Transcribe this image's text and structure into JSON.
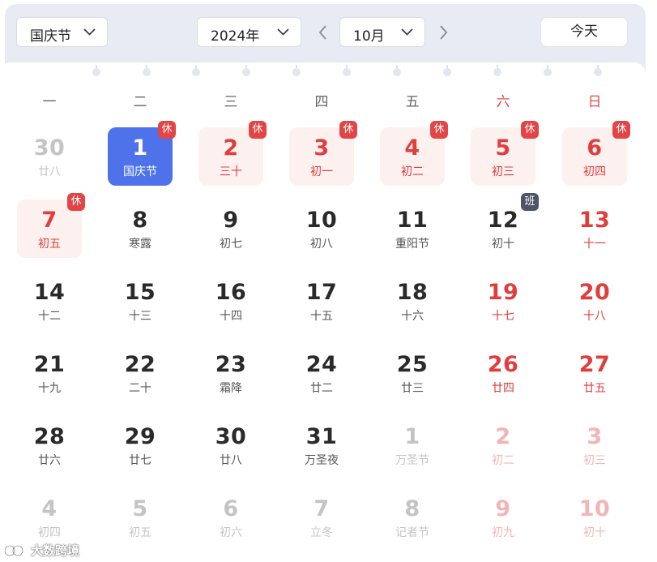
{
  "toolbar": {
    "holiday_select": "国庆节",
    "year_select": "2024年",
    "month_select": "10月",
    "today_label": "今天"
  },
  "weekdays": [
    "一",
    "二",
    "三",
    "四",
    "五",
    "六",
    "日"
  ],
  "days": [
    {
      "day": "30",
      "lunar": "廿八",
      "other": true,
      "red": false,
      "holiday": false,
      "selected": false,
      "badge": ""
    },
    {
      "day": "1",
      "lunar": "国庆节",
      "other": false,
      "red": false,
      "holiday": false,
      "selected": true,
      "badge": "休"
    },
    {
      "day": "2",
      "lunar": "三十",
      "other": false,
      "red": true,
      "holiday": true,
      "selected": false,
      "badge": "休"
    },
    {
      "day": "3",
      "lunar": "初一",
      "other": false,
      "red": true,
      "holiday": true,
      "selected": false,
      "badge": "休"
    },
    {
      "day": "4",
      "lunar": "初二",
      "other": false,
      "red": true,
      "holiday": true,
      "selected": false,
      "badge": "休"
    },
    {
      "day": "5",
      "lunar": "初三",
      "other": false,
      "red": true,
      "holiday": true,
      "selected": false,
      "badge": "休"
    },
    {
      "day": "6",
      "lunar": "初四",
      "other": false,
      "red": true,
      "holiday": true,
      "selected": false,
      "badge": "休"
    },
    {
      "day": "7",
      "lunar": "初五",
      "other": false,
      "red": true,
      "holiday": true,
      "selected": false,
      "badge": "休"
    },
    {
      "day": "8",
      "lunar": "寒露",
      "other": false,
      "red": false,
      "holiday": false,
      "selected": false,
      "badge": ""
    },
    {
      "day": "9",
      "lunar": "初七",
      "other": false,
      "red": false,
      "holiday": false,
      "selected": false,
      "badge": ""
    },
    {
      "day": "10",
      "lunar": "初八",
      "other": false,
      "red": false,
      "holiday": false,
      "selected": false,
      "badge": ""
    },
    {
      "day": "11",
      "lunar": "重阳节",
      "other": false,
      "red": false,
      "holiday": false,
      "selected": false,
      "badge": ""
    },
    {
      "day": "12",
      "lunar": "初十",
      "other": false,
      "red": false,
      "holiday": false,
      "selected": false,
      "badge": "班"
    },
    {
      "day": "13",
      "lunar": "十一",
      "other": false,
      "red": true,
      "holiday": false,
      "selected": false,
      "badge": ""
    },
    {
      "day": "14",
      "lunar": "十二",
      "other": false,
      "red": false,
      "holiday": false,
      "selected": false,
      "badge": ""
    },
    {
      "day": "15",
      "lunar": "十三",
      "other": false,
      "red": false,
      "holiday": false,
      "selected": false,
      "badge": ""
    },
    {
      "day": "16",
      "lunar": "十四",
      "other": false,
      "red": false,
      "holiday": false,
      "selected": false,
      "badge": ""
    },
    {
      "day": "17",
      "lunar": "十五",
      "other": false,
      "red": false,
      "holiday": false,
      "selected": false,
      "badge": ""
    },
    {
      "day": "18",
      "lunar": "十六",
      "other": false,
      "red": false,
      "holiday": false,
      "selected": false,
      "badge": ""
    },
    {
      "day": "19",
      "lunar": "十七",
      "other": false,
      "red": true,
      "holiday": false,
      "selected": false,
      "badge": ""
    },
    {
      "day": "20",
      "lunar": "十八",
      "other": false,
      "red": true,
      "holiday": false,
      "selected": false,
      "badge": ""
    },
    {
      "day": "21",
      "lunar": "十九",
      "other": false,
      "red": false,
      "holiday": false,
      "selected": false,
      "badge": ""
    },
    {
      "day": "22",
      "lunar": "二十",
      "other": false,
      "red": false,
      "holiday": false,
      "selected": false,
      "badge": ""
    },
    {
      "day": "23",
      "lunar": "霜降",
      "other": false,
      "red": false,
      "holiday": false,
      "selected": false,
      "badge": ""
    },
    {
      "day": "24",
      "lunar": "廿二",
      "other": false,
      "red": false,
      "holiday": false,
      "selected": false,
      "badge": ""
    },
    {
      "day": "25",
      "lunar": "廿三",
      "other": false,
      "red": false,
      "holiday": false,
      "selected": false,
      "badge": ""
    },
    {
      "day": "26",
      "lunar": "廿四",
      "other": false,
      "red": true,
      "holiday": false,
      "selected": false,
      "badge": ""
    },
    {
      "day": "27",
      "lunar": "廿五",
      "other": false,
      "red": true,
      "holiday": false,
      "selected": false,
      "badge": ""
    },
    {
      "day": "28",
      "lunar": "廿六",
      "other": false,
      "red": false,
      "holiday": false,
      "selected": false,
      "badge": ""
    },
    {
      "day": "29",
      "lunar": "廿七",
      "other": false,
      "red": false,
      "holiday": false,
      "selected": false,
      "badge": ""
    },
    {
      "day": "30",
      "lunar": "廿八",
      "other": false,
      "red": false,
      "holiday": false,
      "selected": false,
      "badge": ""
    },
    {
      "day": "31",
      "lunar": "万圣夜",
      "other": false,
      "red": false,
      "holiday": false,
      "selected": false,
      "badge": ""
    },
    {
      "day": "1",
      "lunar": "万圣节",
      "other": true,
      "red": false,
      "holiday": false,
      "selected": false,
      "badge": ""
    },
    {
      "day": "2",
      "lunar": "初二",
      "other": true,
      "red": true,
      "holiday": false,
      "selected": false,
      "badge": ""
    },
    {
      "day": "3",
      "lunar": "初三",
      "other": true,
      "red": true,
      "holiday": false,
      "selected": false,
      "badge": ""
    },
    {
      "day": "4",
      "lunar": "初四",
      "other": true,
      "red": false,
      "holiday": false,
      "selected": false,
      "badge": ""
    },
    {
      "day": "5",
      "lunar": "初五",
      "other": true,
      "red": false,
      "holiday": false,
      "selected": false,
      "badge": ""
    },
    {
      "day": "6",
      "lunar": "初六",
      "other": true,
      "red": false,
      "holiday": false,
      "selected": false,
      "badge": ""
    },
    {
      "day": "7",
      "lunar": "立冬",
      "other": true,
      "red": false,
      "holiday": false,
      "selected": false,
      "badge": ""
    },
    {
      "day": "8",
      "lunar": "记者节",
      "other": true,
      "red": false,
      "holiday": false,
      "selected": false,
      "badge": ""
    },
    {
      "day": "9",
      "lunar": "初九",
      "other": true,
      "red": true,
      "holiday": false,
      "selected": false,
      "badge": ""
    },
    {
      "day": "10",
      "lunar": "初十",
      "other": true,
      "red": true,
      "holiday": false,
      "selected": false,
      "badge": ""
    }
  ],
  "watermark": {
    "text": "大数跨境"
  },
  "colors": {
    "accent": "#4e72ea",
    "weekend_red": "#e13d3d",
    "rest_badge": "#e24545",
    "work_badge": "#4d5466",
    "holiday_bg": "#fdf1ef"
  }
}
